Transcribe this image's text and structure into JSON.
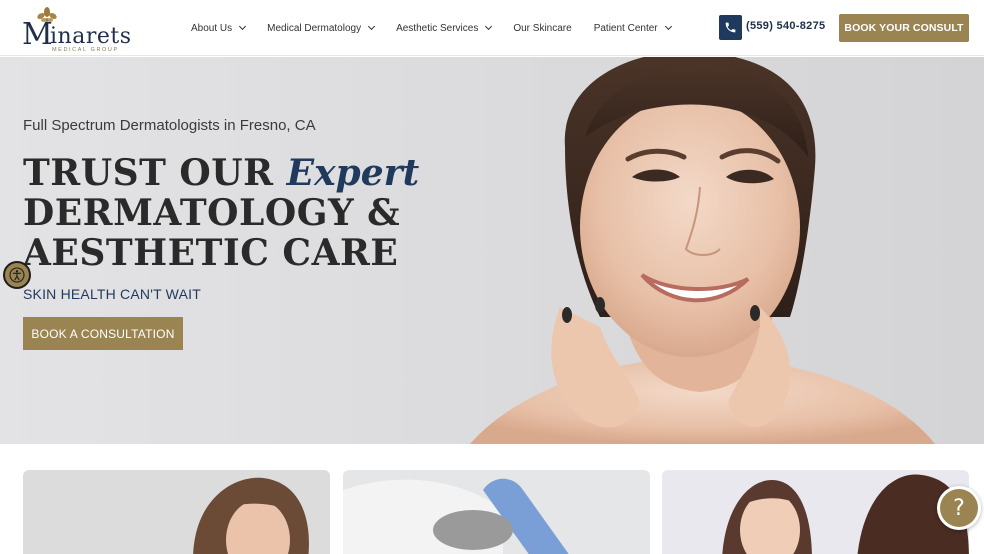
{
  "logo": {
    "initial": "M",
    "name": "inarets",
    "subtitle": "MEDICAL GROUP"
  },
  "nav": {
    "items": [
      {
        "label": "About Us",
        "has_dropdown": true
      },
      {
        "label": "Medical Dermatology",
        "has_dropdown": true
      },
      {
        "label": "Aesthetic Services",
        "has_dropdown": true
      },
      {
        "label": "Our Skincare",
        "has_dropdown": false
      },
      {
        "label": "Patient Center",
        "has_dropdown": true
      }
    ]
  },
  "header": {
    "phone": "(559) 540-8275",
    "book_label": "BOOK YOUR CONSULT"
  },
  "hero": {
    "subtitle": "Full Spectrum Dermatologists in Fresno, CA",
    "title_line1_a": "TRUST OUR ",
    "title_line1_b": "Expert",
    "title_line2": "DERMATOLOGY &",
    "title_line3": "AESTHETIC CARE",
    "tagline": "SKIN HEALTH CAN'T WAIT",
    "cta_label": "BOOK A CONSULTATION"
  },
  "widgets": {
    "help_label": "?"
  },
  "colors": {
    "gold": "#9a8451",
    "navy": "#1f3a5c",
    "hero_bg": "#dcdcde"
  },
  "icons": [
    "flower-logo-icon",
    "chevron-down-icon",
    "phone-icon",
    "accessibility-icon",
    "help-icon"
  ]
}
